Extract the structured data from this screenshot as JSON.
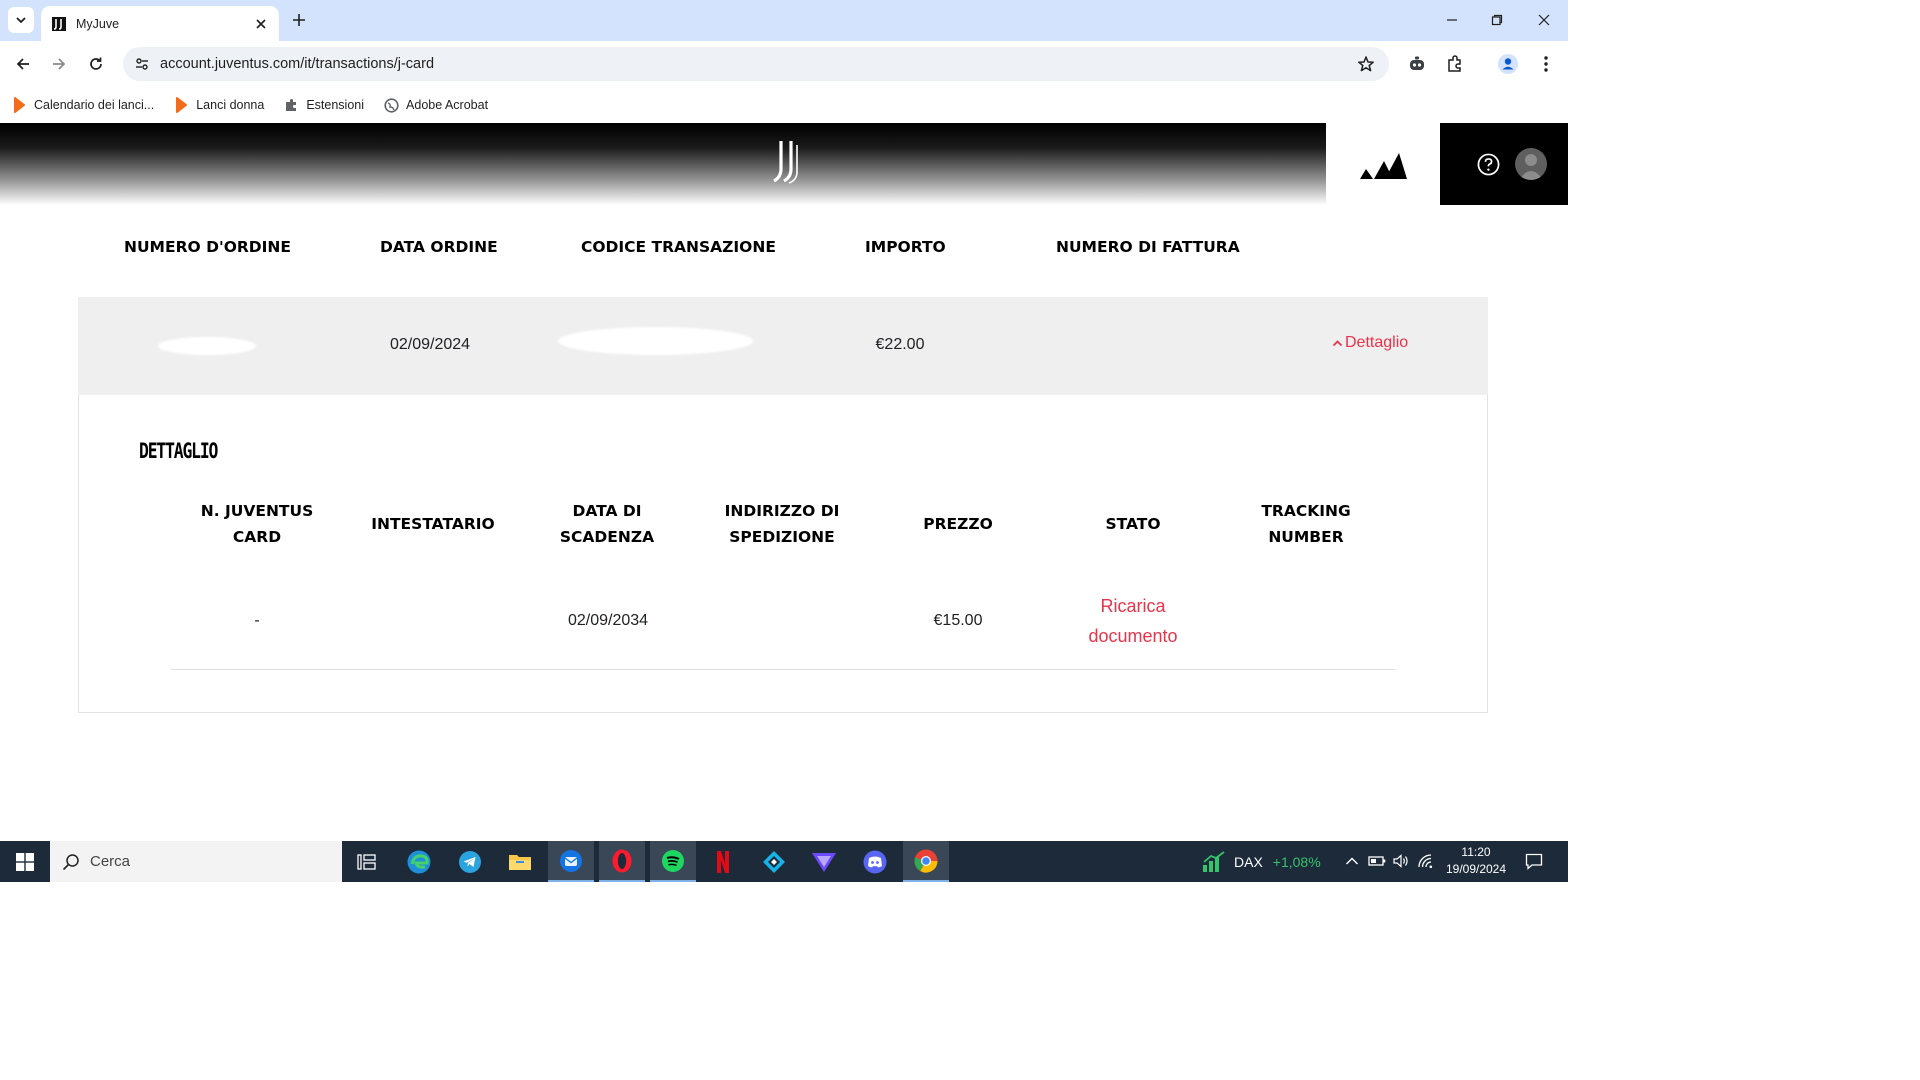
{
  "browser": {
    "tab_title": "MyJuve",
    "url": "account.juventus.com/it/transactions/j-card",
    "bookmarks": [
      {
        "label": "Calendario dei lanci...",
        "icon": "orange-drop-icon"
      },
      {
        "label": "Lanci donna",
        "icon": "orange-drop-icon"
      },
      {
        "label": "Estensioni",
        "icon": "puzzle-icon"
      },
      {
        "label": "Adobe Acrobat",
        "icon": "globe-icon"
      }
    ]
  },
  "orders_table": {
    "headers": [
      "NUMERO D'ORDINE",
      "DATA ORDINE",
      "CODICE TRANSAZIONE",
      "IMPORTO",
      "NUMERO DI FATTURA"
    ],
    "row": {
      "order_number": "",
      "date": "02/09/2024",
      "transaction_code": "",
      "amount": "€22.00",
      "invoice_number": "",
      "detail_link": "Dettaglio"
    }
  },
  "detail": {
    "title": "DETTAGLIO",
    "headers": [
      [
        "N. JUVENTUS",
        "CARD"
      ],
      [
        "INTESTATARIO"
      ],
      [
        "DATA DI",
        "SCADENZA"
      ],
      [
        "INDIRIZZO DI",
        "SPEDIZIONE"
      ],
      [
        "PREZZO"
      ],
      [
        "STATO"
      ],
      [
        "TRACKING",
        "NUMBER"
      ]
    ],
    "row": {
      "card_number": "-",
      "holder": "",
      "expiry": "02/09/2034",
      "address": "",
      "price": "€15.00",
      "status_line1": "Ricarica",
      "status_line2": "documento",
      "tracking": ""
    }
  },
  "taskbar": {
    "search_placeholder": "Cerca",
    "ticker_label": "DAX",
    "ticker_value": "+1,08%",
    "time": "11:20",
    "date": "19/09/2024"
  },
  "colors": {
    "accent_red": "#e8334a",
    "tab_strip": "#d3e3fd",
    "taskbar": "#1c2a3a",
    "ticker_green": "#36c46b"
  }
}
